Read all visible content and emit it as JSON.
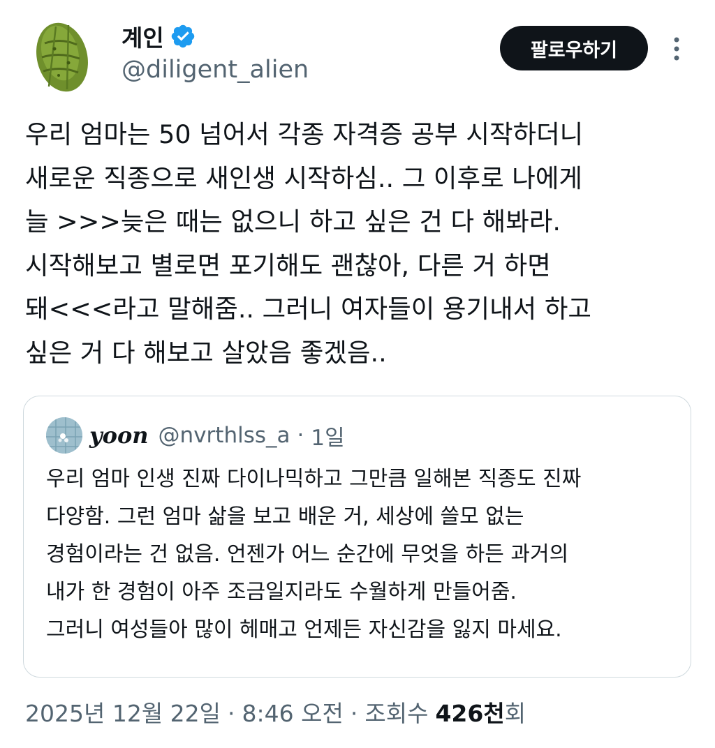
{
  "author": {
    "display_name": "계인",
    "handle": "@diligent_alien",
    "verified": true,
    "avatar_icon": "pickle-avatar-icon"
  },
  "actions": {
    "follow_label": "팔로우하기",
    "more_icon": "more-vertical-icon"
  },
  "tweet": {
    "text": "우리 엄마는 50 넘어서 각종 자격증 공부 시작하더니\n새로운 직종으로 새인생 시작하심.. 그 이후로 나에게\n늘 >>>늦은 때는 없으니 하고 싶은 건 다 해봐라.\n시작해보고 별로면 포기해도 괜찮아, 다른 거 하면\n돼<<<라고 말해줌.. 그러니 여자들이 용기내서 하고\n싶은 거 다 해보고 살았음 좋겠음.."
  },
  "quote": {
    "display_name": "yoon",
    "handle": "@nvrthlss_a",
    "separator": "·",
    "time": "1일",
    "text": "우리 엄마 인생 진짜 다이나믹하고 그만큼 일해본 직종도 진짜\n다양함. 그런 엄마 삶을 보고 배운 거, 세상에 쓸모 없는\n경험이라는 건 없음. 언젠가 어느 순간에 무엇을 하든 과거의\n내가 한 경험이 아주 조금일지라도 수월하게 만들어줌.\n그러니 여성들아 많이 헤매고 언제든 자신감을 잃지 마세요."
  },
  "meta": {
    "date": "2025년 12월 22일",
    "separator": "·",
    "time": "8:46 오전",
    "views_label": "조회수",
    "views_count": "426천",
    "views_suffix": "회"
  },
  "colors": {
    "text": "#0f1419",
    "secondary": "#536471",
    "verified_blue": "#1d9bf0",
    "border": "#cfd9de",
    "button_bg": "#0f1419"
  }
}
